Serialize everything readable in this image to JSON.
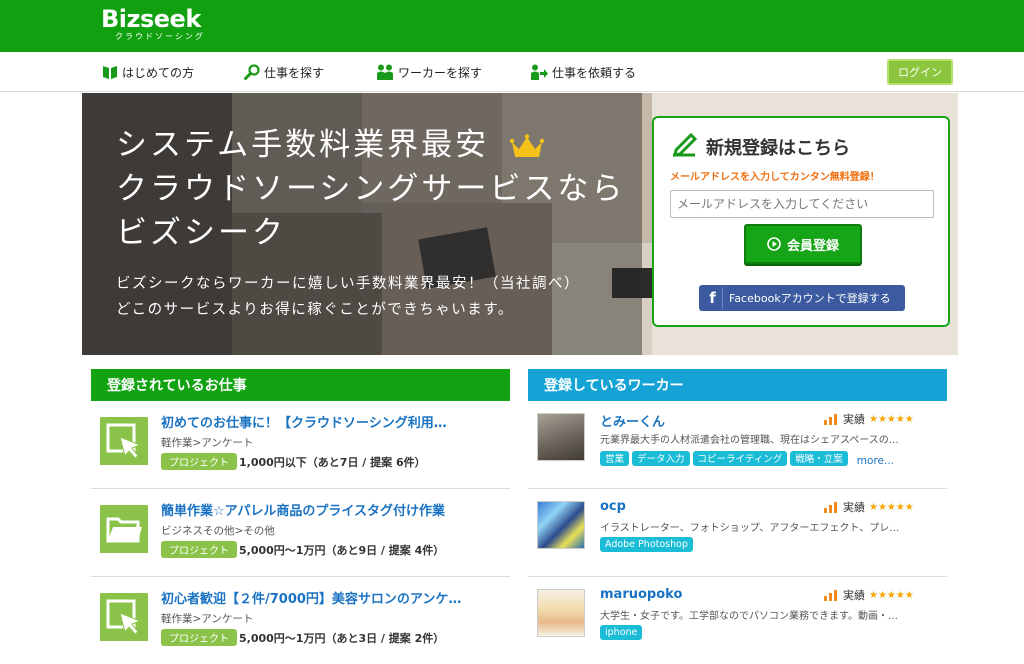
{
  "header": {
    "logo": "Bizseek",
    "logo_sub": "クラウドソーシング"
  },
  "nav": {
    "items": [
      {
        "label": "はじめての方",
        "icon": "book-icon"
      },
      {
        "label": "仕事を探す",
        "icon": "magnifier-icon"
      },
      {
        "label": "ワーカーを探す",
        "icon": "people-icon"
      },
      {
        "label": "仕事を依頼する",
        "icon": "person-arrow-icon"
      }
    ],
    "login": "ログイン"
  },
  "hero": {
    "title_line1": "システム手数料業界最安",
    "title_line2": "クラウドソーシングサービスなら",
    "title_line3": "ビズシーク",
    "desc_line1": "ビズシークならワーカーに嬉しい手数料業界最安！（当社調べ）",
    "desc_line2": "どこのサービスよりお得に稼ぐことができちゃいます。"
  },
  "register": {
    "title": "新規登録はこちら",
    "subtitle": "メールアドレスを入力してカンタン無料登録！",
    "email_placeholder": "メールアドレスを入力してください",
    "email_value": "",
    "submit": "会員登録",
    "facebook_icon_text": "f",
    "facebook": "Facebookアカウントで登録する"
  },
  "colors": {
    "brand_green": "#10a010",
    "worker_blue": "#15a3d6",
    "project_badge": "#8bc34a",
    "link": "#1a73c2"
  },
  "jobs": {
    "heading": "登録されているお仕事",
    "items": [
      {
        "title": "初めてのお仕事に！【クラウドソーシング利用…",
        "category": "軽作業>アンケート",
        "type": "プロジェクト",
        "meta": "1,000円以下（あと7日 / 提案 6件）",
        "icon": "cursor-click-icon"
      },
      {
        "title": "簡単作業☆アパレル商品のプライスタグ付け作業",
        "category": "ビジネスその他>その他",
        "type": "プロジェクト",
        "meta": "5,000円〜1万円（あと9日 / 提案 4件）",
        "icon": "folder-icon"
      },
      {
        "title": "初心者歓迎【２件/7000円】美容サロンのアンケ…",
        "category": "軽作業>アンケート",
        "type": "プロジェクト",
        "meta": "5,000円〜1万円（あと3日 / 提案 2件）",
        "icon": "cursor-click-icon"
      }
    ]
  },
  "workers": {
    "heading": "登録しているワーカー",
    "rating_label": "実績",
    "stars": "★★★★★",
    "items": [
      {
        "name": "とみーくん",
        "desc": "元業界最大手の人材派遣会社の管理職、現在はシェアスペースの…",
        "tags": [
          "営業",
          "データ入力",
          "コピーライティング",
          "戦略・立案"
        ],
        "more": "more..."
      },
      {
        "name": "ocp",
        "desc": "イラストレーター、フォトショップ、アフターエフェクト、プレ…",
        "tags": [
          "Adobe Photoshop"
        ],
        "more": ""
      },
      {
        "name": "maruopoko",
        "desc": "大学生・女子です。工学部なのでパソコン業務できます。動画・…",
        "tags": [
          "iphone"
        ],
        "more": ""
      }
    ]
  }
}
